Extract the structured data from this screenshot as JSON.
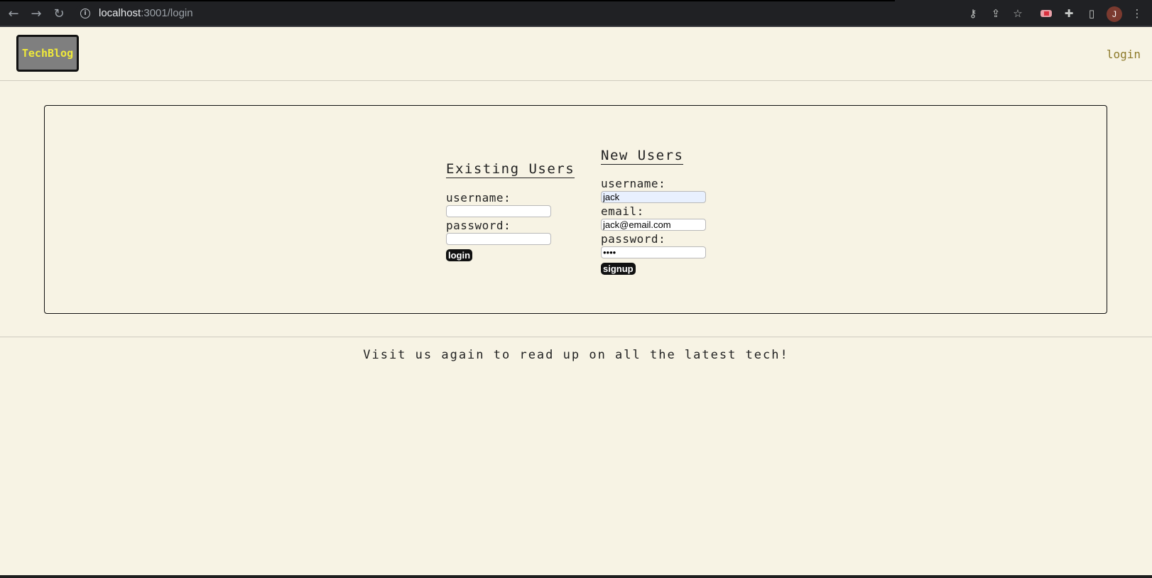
{
  "browser": {
    "url_host": "localhost",
    "url_rest": ":3001/login",
    "profile_initial": "J",
    "icons": [
      "back-arrow-icon",
      "forward-arrow-icon",
      "reload-icon",
      "info-icon",
      "key-icon",
      "share-icon",
      "star-icon",
      "extension-icon",
      "puzzle-icon",
      "side-panel-icon",
      "more-vert-icon"
    ]
  },
  "header": {
    "logo": "TechBlog",
    "login_link": "login",
    "logo_text_color": "#f0ea3a",
    "logo_bg_color": "#7f7f7f"
  },
  "existing_users": {
    "title": "Existing Users",
    "username_label": "username:",
    "username_value": "",
    "password_label": "password:",
    "password_value": "",
    "submit_label": "login"
  },
  "new_users": {
    "title": "New Users",
    "username_label": "username:",
    "username_value": "jack",
    "email_label": "email:",
    "email_value": "jack@email.com",
    "password_label": "password:",
    "password_value": "••••",
    "submit_label": "signup"
  },
  "footer": {
    "text": "Visit us again to read up on all the latest tech!"
  },
  "colors": {
    "page_bg": "#f7f3e4",
    "link": "#8d7a2a",
    "button_bg": "#111111"
  }
}
